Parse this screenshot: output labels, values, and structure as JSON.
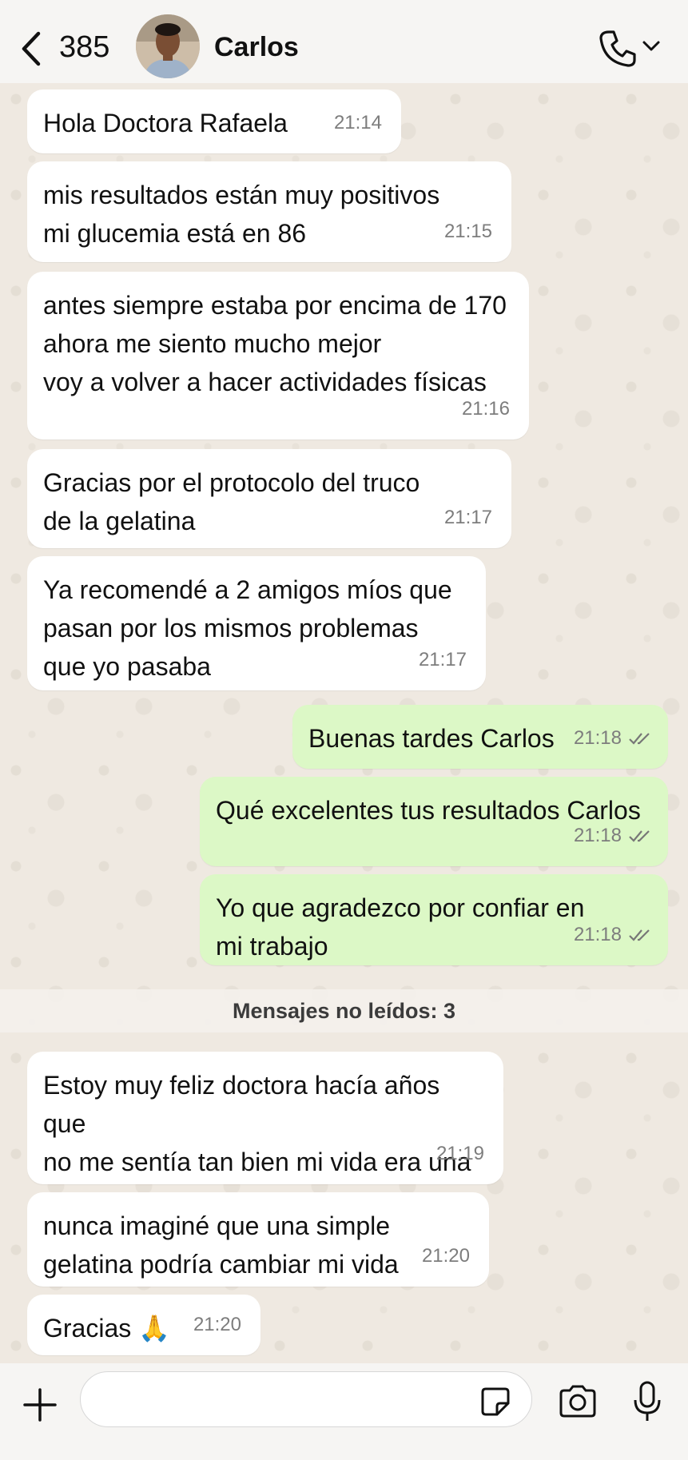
{
  "header": {
    "back_count": "385",
    "contact_name": "Carlos"
  },
  "messages": [
    {
      "direction": "in",
      "text": "Hola Doctora Rafaela",
      "time": "21:14"
    },
    {
      "direction": "in",
      "text": "mis resultados están muy positivos\nmi glucemia está en 86",
      "time": "21:15"
    },
    {
      "direction": "in",
      "text": "antes siempre estaba por encima de 170\nahora me siento mucho mejor\nvoy a volver a hacer actividades físicas",
      "time": "21:16"
    },
    {
      "direction": "in",
      "text": "Gracias por el protocolo del truco\nde la gelatina",
      "time": "21:17"
    },
    {
      "direction": "in",
      "text": "Ya recomendé a 2 amigos míos que\npasan por los mismos problemas\nque yo pasaba",
      "time": "21:17"
    },
    {
      "direction": "out",
      "text": "Buenas tardes Carlos",
      "time": "21:18",
      "status": "read"
    },
    {
      "direction": "out",
      "text": "Qué excelentes tus resultados Carlos",
      "time": "21:18",
      "status": "read"
    },
    {
      "direction": "out",
      "text": "Yo que agradezco por confiar en\nmi trabajo",
      "time": "21:18",
      "status": "read"
    },
    {
      "direction": "in",
      "text": "Estoy muy feliz doctora hacía años que\nno me sentía tan bien mi vida era una y\notra ahora",
      "time": "21:19"
    },
    {
      "direction": "in",
      "text": "nunca imaginé que una simple\ngelatina podría cambiar mi vida",
      "time": "21:20"
    },
    {
      "direction": "in",
      "text": "Gracias 🙏",
      "time": "21:20"
    }
  ],
  "unread_label": "Mensajes no leídos:  3",
  "composer": {
    "value": "",
    "placeholder": ""
  },
  "colors": {
    "incoming_bubble": "#ffffff",
    "outgoing_bubble": "#dcf8c6",
    "wallpaper": "#efe9e1",
    "bars": "#f6f5f3"
  },
  "icons": [
    "back-chevron-icon",
    "voice-call-icon",
    "chevron-down-icon",
    "plus-icon",
    "sticker-icon",
    "camera-icon",
    "microphone-icon",
    "double-check-icon"
  ]
}
